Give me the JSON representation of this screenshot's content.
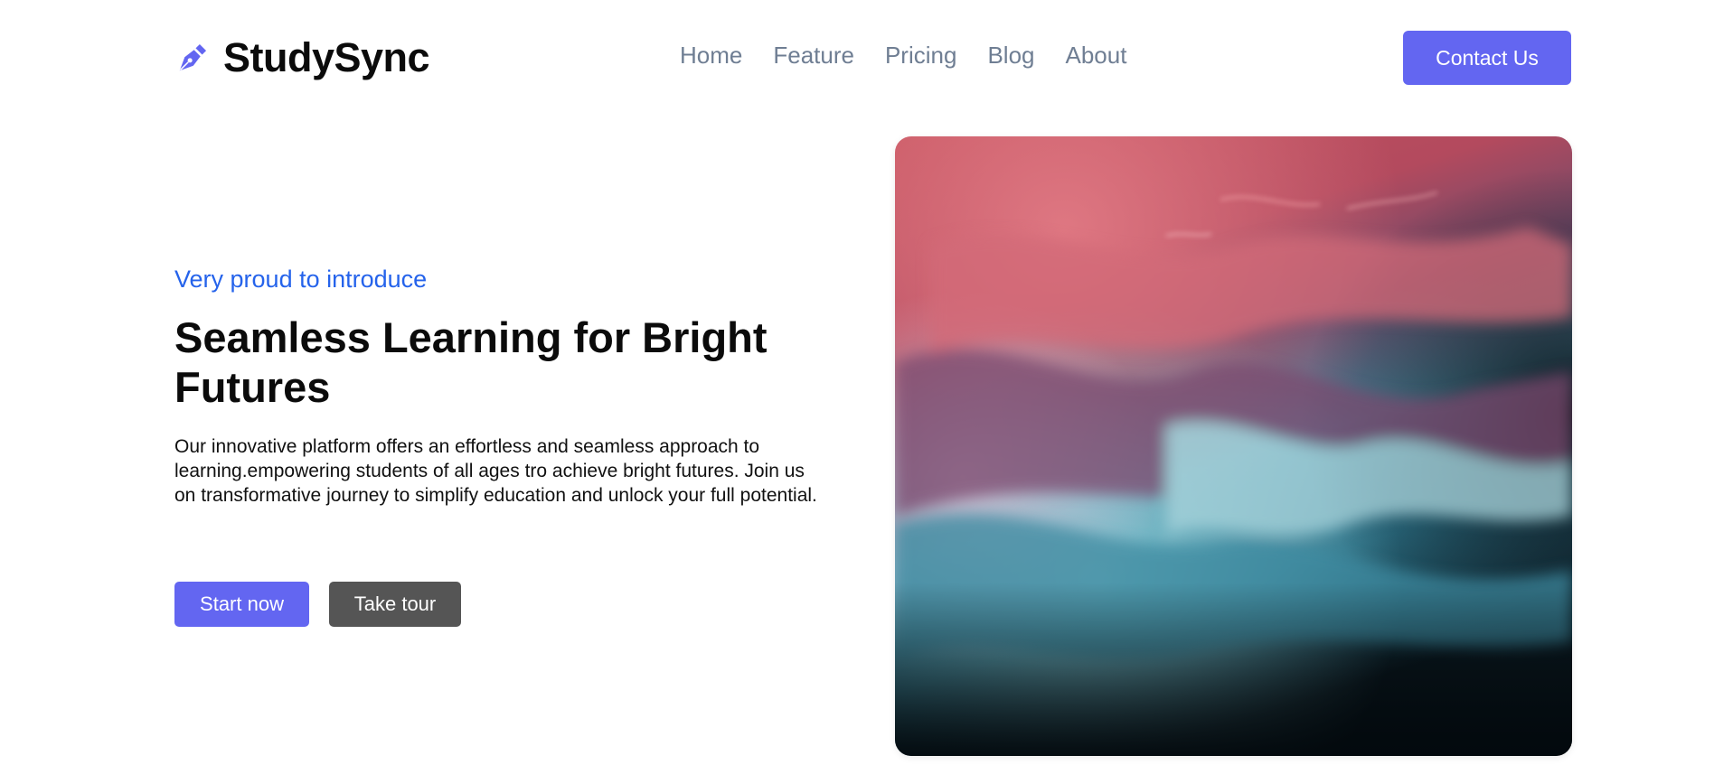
{
  "header": {
    "brand_name": "StudySync",
    "brand_icon": "pen-nib-icon",
    "nav": [
      "Home",
      "Feature",
      "Pricing",
      "Blog",
      "About"
    ],
    "contact_label": "Contact Us"
  },
  "hero": {
    "eyebrow": "Very proud to introduce",
    "title": "Seamless Learning for Bright Futures",
    "description": "Our innovative platform offers an effortless and seamless approach to learning.empowering students of all ages tro achieve bright futures. Join us on transformative journey to simplify education and unlock your full potential.",
    "primary_cta": "Start now",
    "secondary_cta": "Take tour"
  },
  "colors": {
    "accent": "#6366f1",
    "eyebrow": "#2563eb",
    "nav_text": "#6f7e93",
    "secondary_button": "#555555"
  }
}
